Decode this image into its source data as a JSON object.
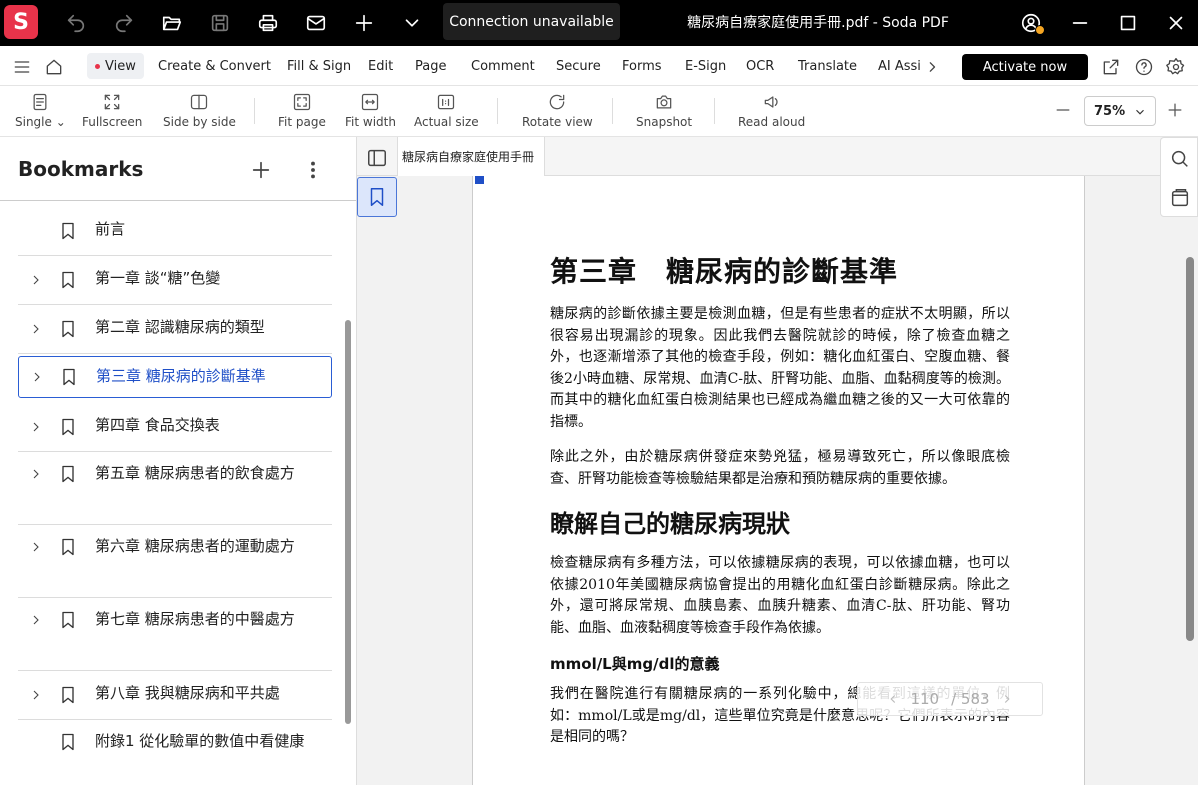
{
  "app": {
    "logo_letter": "S",
    "connection_status": "Connection unavailable",
    "window_title": "糖尿病自療家庭使用手冊.pdf  -  Soda PDF",
    "brand_color": "#e8334a",
    "accent_color": "#1f4fc7"
  },
  "menu": {
    "items": [
      {
        "label": "View",
        "active": true
      },
      {
        "label": "Create & Convert"
      },
      {
        "label": "Fill & Sign"
      },
      {
        "label": "Edit"
      },
      {
        "label": "Page"
      },
      {
        "label": "Comment"
      },
      {
        "label": "Secure"
      },
      {
        "label": "Forms"
      },
      {
        "label": "E-Sign"
      },
      {
        "label": "OCR"
      },
      {
        "label": "Translate"
      },
      {
        "label": "AI Assis"
      }
    ],
    "activate_label": "Activate now"
  },
  "toolbar": {
    "single": "Single",
    "fullscreen": "Fullscreen",
    "side_by_side": "Side by side",
    "fit_page": "Fit page",
    "fit_width": "Fit width",
    "actual_size": "Actual size",
    "rotate_view": "Rotate view",
    "snapshot": "Snapshot",
    "read_aloud": "Read aloud",
    "zoom": "75%"
  },
  "bookmarks": {
    "title": "Bookmarks",
    "items": [
      {
        "label": "前言",
        "expandable": false
      },
      {
        "label": "第一章 談“糖”色變",
        "expandable": true
      },
      {
        "label": "第二章 認識糖尿病的類型",
        "expandable": true
      },
      {
        "label": "第三章 糖尿病的診斷基準",
        "expandable": true,
        "selected": true
      },
      {
        "label": "第四章 食品交換表",
        "expandable": true
      },
      {
        "label": "第五章 糖尿病患者的飲食處方",
        "expandable": true
      },
      {
        "label": "第六章 糖尿病患者的運動處方",
        "expandable": true
      },
      {
        "label": "第七章 糖尿病患者的中醫處方",
        "expandable": true
      },
      {
        "label": "第八章 我與糖尿病和平共處",
        "expandable": true
      },
      {
        "label": "附錄1 從化驗單的數值中看健康",
        "expandable": false
      }
    ]
  },
  "document": {
    "tab_label": "糖尿病自療家庭使用手冊",
    "chapter_title": "第三章　糖尿病的診斷基準",
    "para1": "糖尿病的診斷依據主要是檢測血糖，但是有些患者的症狀不太明顯，所以很容易出現漏診的現象。因此我們去醫院就診的時候，除了檢查血糖之外，也逐漸增添了其他的檢查手段，例如：糖化血紅蛋白、空腹血糖、餐後2小時血糖、尿常規、血清C-肽、肝腎功能、血脂、血黏稠度等的檢測。而其中的糖化血紅蛋白檢測結果也已經成為繼血糖之後的又一大可依靠的指標。",
    "para2": "除此之外，由於糖尿病併發症來勢兇猛，極易導致死亡，所以像眼底檢查、肝腎功能檢查等檢驗結果都是治療和預防糖尿病的重要依據。",
    "section_title": "瞭解自己的糖尿病現狀",
    "para3": "檢查糖尿病有多種方法，可以依據糖尿病的表現，可以依據血糖，也可以依據2010年美國糖尿病協會提出的用糖化血紅蛋白診斷糖尿病。除此之外，還可將尿常規、血胰島素、血胰升糖素、血清C-肽、肝功能、腎功能、血脂、血液黏稠度等檢查手段作為依據。",
    "subsection_title": "mmol/L與mg/dl的意義",
    "para4": "我們在醫院進行有關糖尿病的一系列化驗中，總能看到這樣的單位，例如：mmol/L或是mg/dl，這些單位究竟是什麼意思呢？它們所表示的內容是相同的嗎？",
    "current_page": "110",
    "total_pages": "/ 583"
  }
}
